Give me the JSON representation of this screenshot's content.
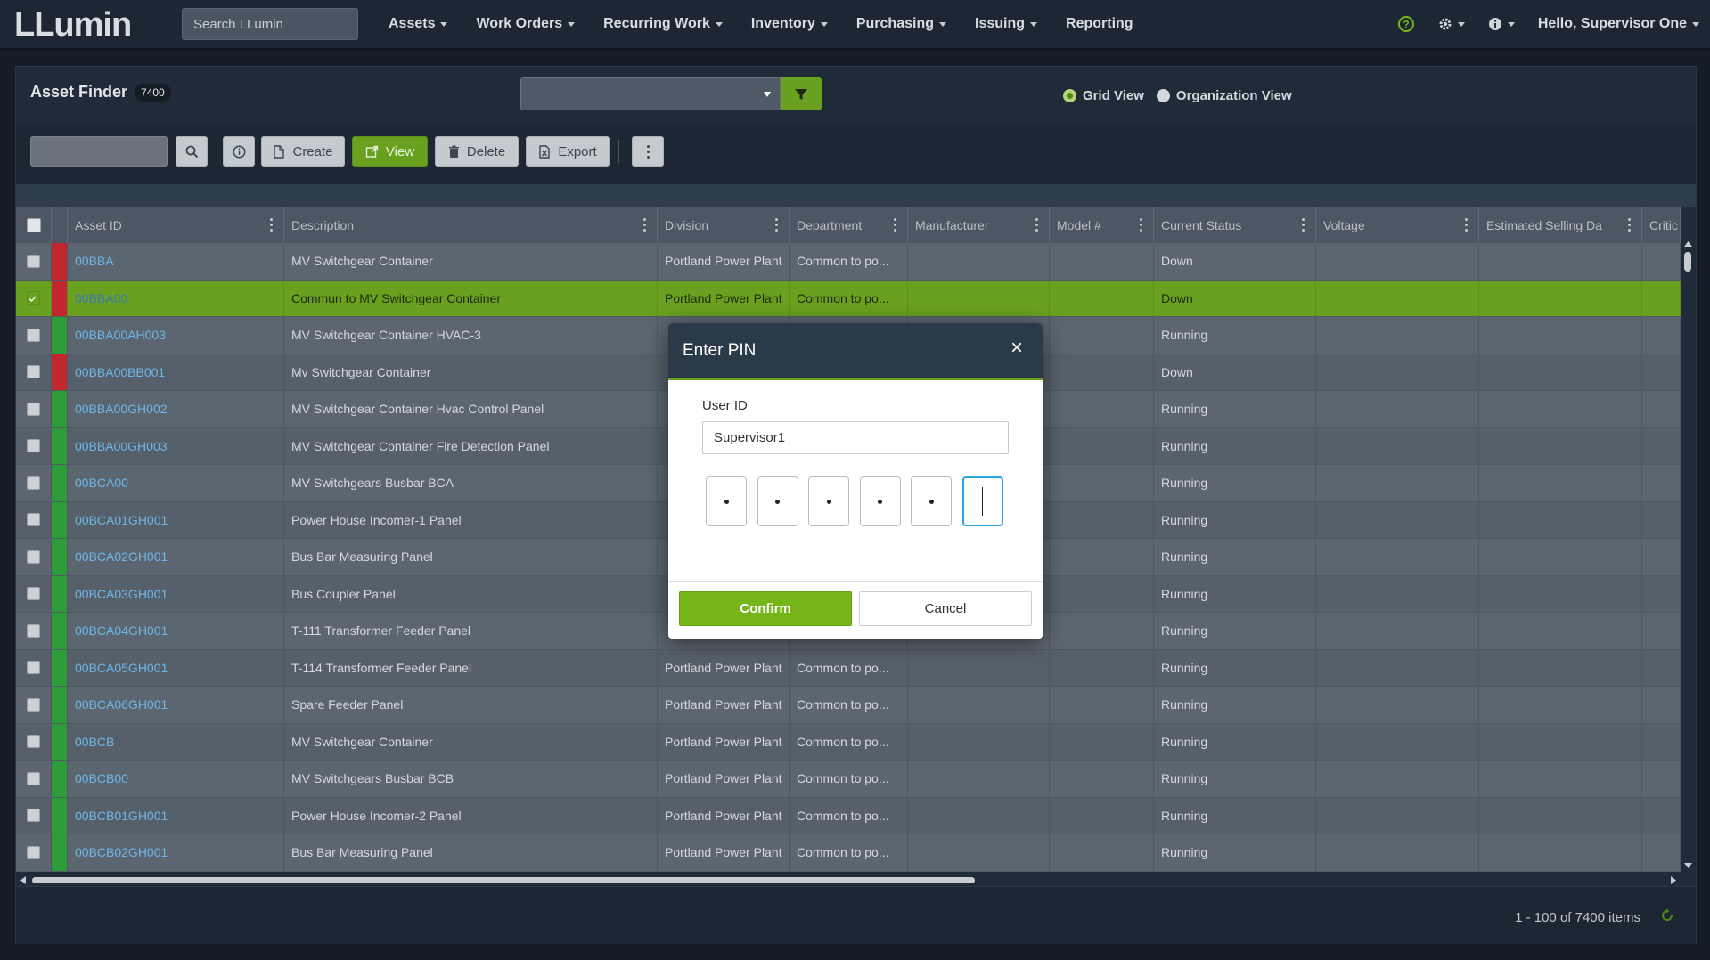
{
  "brand": {
    "logo_text": "LLumin"
  },
  "nav": {
    "search_placeholder": "Search LLumin",
    "menu": [
      "Assets",
      "Work Orders",
      "Recurring Work",
      "Inventory",
      "Purchasing",
      "Issuing",
      "Reporting"
    ],
    "greeting": "Hello, Supervisor One"
  },
  "finder": {
    "title": "Asset Finder",
    "count": "7400",
    "views": [
      "Grid View",
      "Organization View"
    ],
    "selected_view": "Grid View"
  },
  "toolbar": {
    "create": "Create",
    "view": "View",
    "delete": "Delete",
    "export": "Export"
  },
  "grid": {
    "columns": [
      "Asset ID",
      "Description",
      "Division",
      "Department",
      "Manufacturer",
      "Model #",
      "Current Status",
      "Voltage",
      "Estimated Selling Da",
      "Critic"
    ],
    "rows": [
      {
        "id": "00BBA",
        "desc": "MV Switchgear Container",
        "division": "Portland Power Plant",
        "dept": "Common to po...",
        "status": "Down",
        "flag": "red"
      },
      {
        "id": "00BBA00",
        "desc": "Commun to MV Switchgear Container",
        "division": "Portland Power Plant",
        "dept": "Common to po...",
        "status": "Down",
        "flag": "red",
        "selected": true
      },
      {
        "id": "00BBA00AH003",
        "desc": "MV Switchgear Container HVAC-3",
        "division": "",
        "dept": "",
        "status": "Running",
        "flag": "green"
      },
      {
        "id": "00BBA00BB001",
        "desc": "Mv Switchgear Container",
        "division": "",
        "dept": "",
        "status": "Down",
        "flag": "red"
      },
      {
        "id": "00BBA00GH002",
        "desc": "MV Switchgear Container Hvac Control Panel",
        "division": "",
        "dept": "",
        "status": "Running",
        "flag": "green"
      },
      {
        "id": "00BBA00GH003",
        "desc": "MV Switchgear Container Fire Detection Panel",
        "division": "",
        "dept": "",
        "status": "Running",
        "flag": "green"
      },
      {
        "id": "00BCA00",
        "desc": "MV Switchgears Busbar BCA",
        "division": "",
        "dept": "",
        "status": "Running",
        "flag": "green"
      },
      {
        "id": "00BCA01GH001",
        "desc": "Power House Incomer-1 Panel",
        "division": "",
        "dept": "",
        "status": "Running",
        "flag": "green"
      },
      {
        "id": "00BCA02GH001",
        "desc": "Bus Bar Measuring Panel",
        "division": "",
        "dept": "",
        "status": "Running",
        "flag": "green"
      },
      {
        "id": "00BCA03GH001",
        "desc": "Bus Coupler Panel",
        "division": "",
        "dept": "",
        "status": "Running",
        "flag": "green"
      },
      {
        "id": "00BCA04GH001",
        "desc": "T-111 Transformer Feeder Panel",
        "division": "",
        "dept": "",
        "status": "Running",
        "flag": "green"
      },
      {
        "id": "00BCA05GH001",
        "desc": "T-114 Transformer Feeder Panel",
        "division": "Portland Power Plant",
        "dept": "Common to po...",
        "status": "Running",
        "flag": "green"
      },
      {
        "id": "00BCA06GH001",
        "desc": "Spare Feeder Panel",
        "division": "Portland Power Plant",
        "dept": "Common to po...",
        "status": "Running",
        "flag": "green"
      },
      {
        "id": "00BCB",
        "desc": "MV Switchgear Container",
        "division": "Portland Power Plant",
        "dept": "Common to po...",
        "status": "Running",
        "flag": "green"
      },
      {
        "id": "00BCB00",
        "desc": "MV Switchgears Busbar BCB",
        "division": "Portland Power Plant",
        "dept": "Common to po...",
        "status": "Running",
        "flag": "green"
      },
      {
        "id": "00BCB01GH001",
        "desc": "Power House Incomer-2 Panel",
        "division": "Portland Power Plant",
        "dept": "Common to po...",
        "status": "Running",
        "flag": "green"
      },
      {
        "id": "00BCB02GH001",
        "desc": "Bus Bar Measuring Panel",
        "division": "Portland Power Plant",
        "dept": "Common to po...",
        "status": "Running",
        "flag": "green"
      }
    ]
  },
  "pager": {
    "info": "1 - 100 of 7400 items"
  },
  "modal": {
    "title": "Enter PIN",
    "user_id_label": "User ID",
    "user_id_value": "Supervisor1",
    "pin_filled": 5,
    "pin_length": 6,
    "confirm": "Confirm",
    "cancel": "Cancel"
  },
  "colors": {
    "accent_green": "#6aa01f",
    "status_red": "#c2262e",
    "status_green": "#2e9c38",
    "link_blue": "#6fb6e6"
  }
}
